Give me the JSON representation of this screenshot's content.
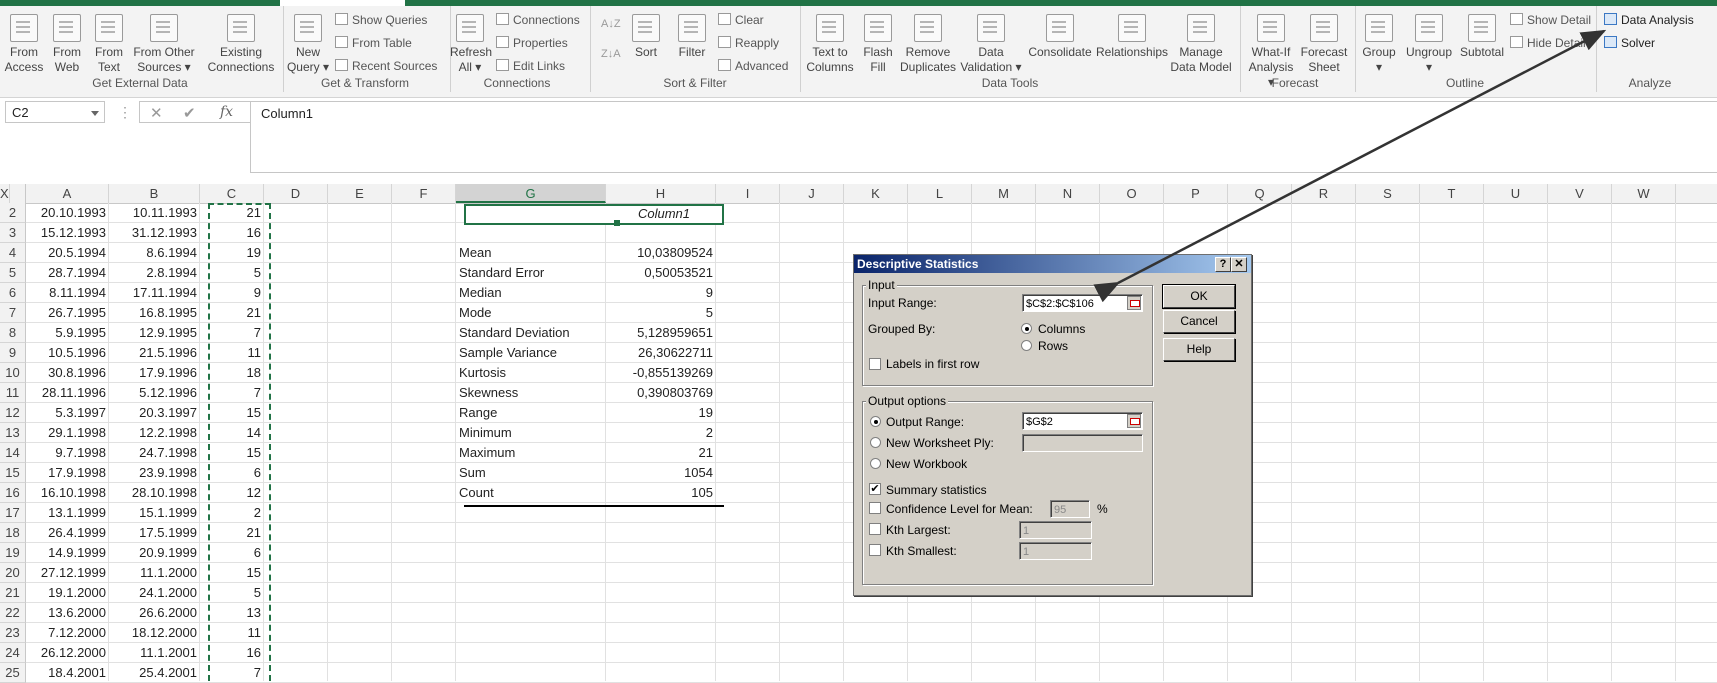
{
  "ribbon": {
    "get_external_data": {
      "label": "Get External Data",
      "buttons": [
        {
          "l1": "From",
          "l2": "Access"
        },
        {
          "l1": "From",
          "l2": "Web"
        },
        {
          "l1": "From",
          "l2": "Text"
        },
        {
          "l1": "From Other",
          "l2": "Sources ▾"
        },
        {
          "l1": "Existing",
          "l2": "Connections"
        }
      ]
    },
    "get_transform": {
      "label": "Get & Transform",
      "new_query": {
        "l1": "New",
        "l2": "Query ▾"
      },
      "small": [
        "Show Queries",
        "From Table",
        "Recent Sources"
      ]
    },
    "connections": {
      "label": "Connections",
      "refresh": {
        "l1": "Refresh",
        "l2": "All ▾"
      },
      "small": [
        "Connections",
        "Properties",
        "Edit Links"
      ]
    },
    "sort_filter": {
      "label": "Sort & Filter",
      "sort": "Sort",
      "filter": "Filter",
      "small": [
        "Clear",
        "Reapply",
        "Advanced"
      ]
    },
    "data_tools": {
      "label": "Data Tools",
      "buttons": [
        {
          "l1": "Text to",
          "l2": "Columns"
        },
        {
          "l1": "Flash",
          "l2": "Fill"
        },
        {
          "l1": "Remove",
          "l2": "Duplicates"
        },
        {
          "l1": "Data",
          "l2": "Validation ▾"
        },
        {
          "l1": "Consolidate",
          "l2": ""
        },
        {
          "l1": "Relationships",
          "l2": ""
        },
        {
          "l1": "Manage",
          "l2": "Data Model"
        }
      ]
    },
    "forecast": {
      "label": "Forecast",
      "buttons": [
        {
          "l1": "What-If",
          "l2": "Analysis ▾"
        },
        {
          "l1": "Forecast",
          "l2": "Sheet"
        }
      ]
    },
    "outline": {
      "label": "Outline",
      "buttons": [
        {
          "l1": "Group",
          "l2": "▾"
        },
        {
          "l1": "Ungroup",
          "l2": "▾"
        },
        {
          "l1": "Subtotal",
          "l2": ""
        }
      ],
      "small": [
        "Show Detail",
        "Hide Detail"
      ]
    },
    "analyze": {
      "label": "Analyze",
      "small": [
        "Data Analysis",
        "Solver"
      ]
    }
  },
  "formula_bar": {
    "name_box": "C2",
    "cancel": "✕",
    "enter": "✔",
    "fx": "fx",
    "content": "Column1"
  },
  "columns": [
    "A",
    "B",
    "C",
    "D",
    "E",
    "F",
    "G",
    "H",
    "I",
    "J",
    "K",
    "L",
    "M",
    "N",
    "O",
    "P",
    "Q",
    "R",
    "S",
    "T",
    "U",
    "V",
    "W",
    "X"
  ],
  "rows": [
    "2",
    "3",
    "4",
    "5",
    "6",
    "7",
    "8",
    "9",
    "10",
    "11",
    "12",
    "13",
    "14",
    "15",
    "16",
    "17",
    "18",
    "19",
    "20",
    "21",
    "22",
    "23",
    "24",
    "25"
  ],
  "data_rows": [
    [
      "20.10.1993",
      "10.11.1993",
      "21"
    ],
    [
      "15.12.1993",
      "31.12.1993",
      "16"
    ],
    [
      "20.5.1994",
      "8.6.1994",
      "19"
    ],
    [
      "28.7.1994",
      "2.8.1994",
      "5"
    ],
    [
      "8.11.1994",
      "17.11.1994",
      "9"
    ],
    [
      "26.7.1995",
      "16.8.1995",
      "21"
    ],
    [
      "5.9.1995",
      "12.9.1995",
      "7"
    ],
    [
      "10.5.1996",
      "21.5.1996",
      "11"
    ],
    [
      "30.8.1996",
      "17.9.1996",
      "18"
    ],
    [
      "28.11.1996",
      "5.12.1996",
      "7"
    ],
    [
      "5.3.1997",
      "20.3.1997",
      "15"
    ],
    [
      "29.1.1998",
      "12.2.1998",
      "14"
    ],
    [
      "9.7.1998",
      "24.7.1998",
      "15"
    ],
    [
      "17.9.1998",
      "23.9.1998",
      "6"
    ],
    [
      "16.10.1998",
      "28.10.1998",
      "12"
    ],
    [
      "13.1.1999",
      "15.1.1999",
      "2"
    ],
    [
      "26.4.1999",
      "17.5.1999",
      "21"
    ],
    [
      "14.9.1999",
      "20.9.1999",
      "6"
    ],
    [
      "27.12.1999",
      "11.1.2000",
      "15"
    ],
    [
      "19.1.2000",
      "24.1.2000",
      "5"
    ],
    [
      "13.6.2000",
      "26.6.2000",
      "13"
    ],
    [
      "7.12.2000",
      "18.12.2000",
      "11"
    ],
    [
      "26.12.2000",
      "11.1.2001",
      "16"
    ],
    [
      "18.4.2001",
      "25.4.2001",
      "7"
    ]
  ],
  "stats": {
    "header": "Column1",
    "rows": [
      [
        "Mean",
        "10,03809524"
      ],
      [
        "Standard Error",
        "0,50053521"
      ],
      [
        "Median",
        "9"
      ],
      [
        "Mode",
        "5"
      ],
      [
        "Standard Deviation",
        "5,128959651"
      ],
      [
        "Sample Variance",
        "26,30622711"
      ],
      [
        "Kurtosis",
        "-0,855139269"
      ],
      [
        "Skewness",
        "0,390803769"
      ],
      [
        "Range",
        "19"
      ],
      [
        "Minimum",
        "2"
      ],
      [
        "Maximum",
        "21"
      ],
      [
        "Sum",
        "1054"
      ],
      [
        "Count",
        "105"
      ]
    ]
  },
  "dialog": {
    "title": "Descriptive Statistics",
    "help_glyph": "?",
    "close_glyph": "✕",
    "input_legend": "Input",
    "input_range_label": "Input Range:",
    "input_range_value": "$C$2:$C$106",
    "grouped_by_label": "Grouped By:",
    "columns_label": "Columns",
    "rows_label": "Rows",
    "labels_first_row": "Labels in first row",
    "output_legend": "Output options",
    "output_range_label": "Output Range:",
    "output_range_value": "$G$2",
    "new_worksheet_label": "New Worksheet Ply:",
    "new_workbook_label": "New Workbook",
    "summary_stats_label": "Summary statistics",
    "confidence_label": "Confidence Level for Mean:",
    "confidence_value": "95",
    "percent": "%",
    "kth_largest_label": "Kth Largest:",
    "kth_largest_value": "1",
    "kth_smallest_label": "Kth Smallest:",
    "kth_smallest_value": "1",
    "ok": "OK",
    "cancel": "Cancel",
    "help": "Help",
    "check_mark": "✔"
  },
  "colors": {
    "excel_green": "#217346",
    "annotation_arrow": "#333333"
  }
}
